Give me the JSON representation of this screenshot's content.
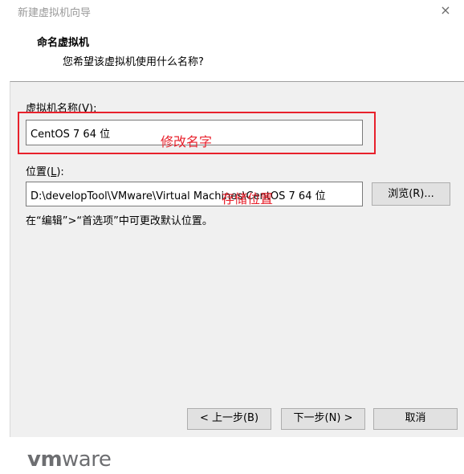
{
  "window": {
    "title": "新建虚拟机向导",
    "close_glyph": "×"
  },
  "header": {
    "heading": "命名虚拟机",
    "subheading": "您希望该虚拟机使用什么名称?"
  },
  "form": {
    "name_label": "虚拟机名称",
    "name_accel": "V",
    "name_value": "CentOS 7 64 位",
    "location_label": "位置",
    "location_accel": "L",
    "location_value": "D:\\developTool\\VMware\\Virtual Machines\\CentOS 7 64 位",
    "browse_label": "浏览(R)...",
    "hint": "在“编辑”>“首选项”中可更改默认位置。"
  },
  "annotations": {
    "rename": "修改名字",
    "storage": "存储位置",
    "highlight_color": "#e8212c"
  },
  "buttons": {
    "back": "< 上一步(B)",
    "next": "下一步(N) >",
    "cancel": "取消"
  },
  "footer": {
    "logo_vm": "vm",
    "logo_ware": "ware"
  }
}
